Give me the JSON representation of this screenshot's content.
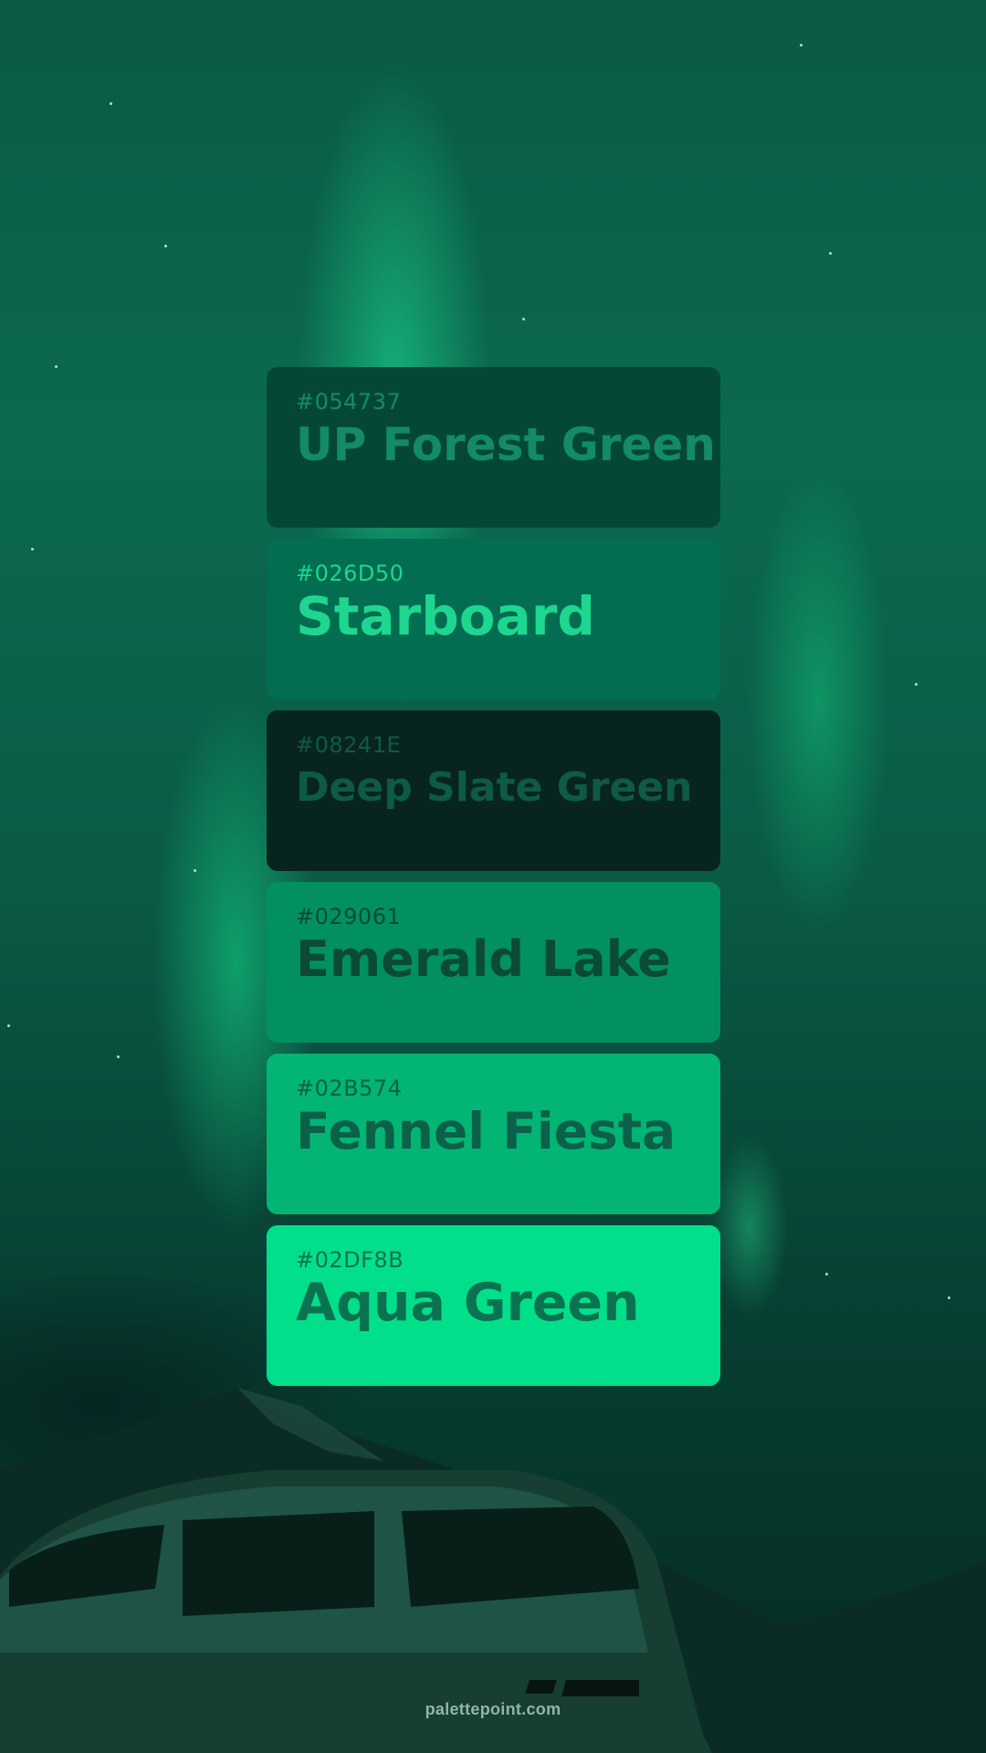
{
  "swatches": [
    {
      "hex": "#054737",
      "name": "UP Forest Green",
      "bg": "#054737",
      "fg": "#138a68"
    },
    {
      "hex": "#026D50",
      "name": "Starboard",
      "bg": "#026D50",
      "fg": "#1ed68f"
    },
    {
      "hex": "#08241E",
      "name": "Deep Slate Green",
      "bg": "#08241E",
      "fg": "#0e5a44"
    },
    {
      "hex": "#029061",
      "name": "Emerald Lake",
      "bg": "#029061",
      "fg": "#0a4a36"
    },
    {
      "hex": "#02B574",
      "name": "Fennel Fiesta",
      "bg": "#02B574",
      "fg": "#0a6048"
    },
    {
      "hex": "#02DF8B",
      "name": "Aqua Green",
      "bg": "#02DF8B",
      "fg": "#0a7250"
    }
  ],
  "footer": {
    "text": "palettepoint.com"
  }
}
